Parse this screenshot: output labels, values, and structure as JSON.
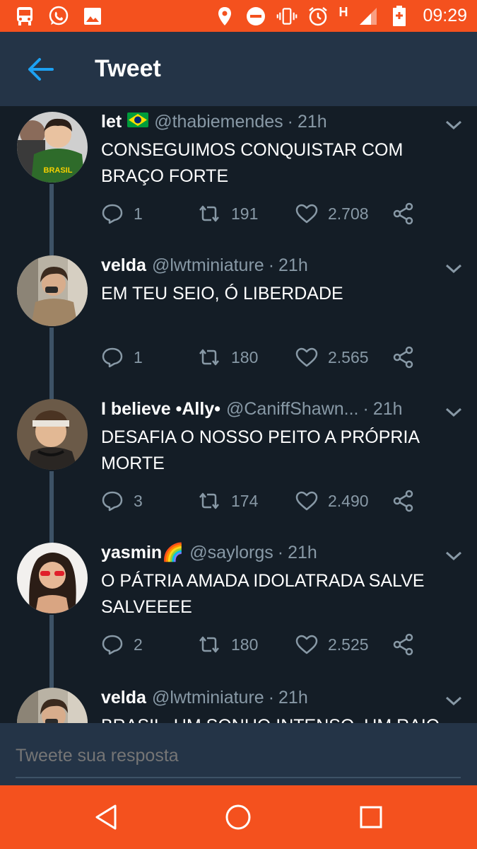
{
  "status_bar": {
    "time": "09:29",
    "network": "H",
    "left_icons": [
      "bus-icon",
      "whatsapp-icon",
      "image-icon"
    ],
    "right_icons": [
      "location-icon",
      "dnd-icon",
      "vibrate-icon",
      "alarm-icon",
      "signal-icon",
      "battery-icon"
    ]
  },
  "app_bar": {
    "title": "Tweet"
  },
  "tweets": [
    {
      "name": "let",
      "flag": "🇧🇷",
      "handle": "@thabiemendes",
      "dot": "·",
      "time": "21h",
      "text": "CONSEGUIMOS CONQUISTAR COM BRAÇO FORTE",
      "replies": "1",
      "retweets": "191",
      "likes": "2.708",
      "avatar_text": "BRASIL"
    },
    {
      "name": "velda",
      "handle": "@lwtminiature",
      "dot": "·",
      "time": "21h",
      "text": "EM TEU SEIO, Ó LIBERDADE",
      "replies": "1",
      "retweets": "180",
      "likes": "2.565"
    },
    {
      "name": "I believe •Ally•",
      "handle": "@CaniffShawn...",
      "dot": "·",
      "time": "21h",
      "text": "DESAFIA O NOSSO PEITO A PRÓPRIA MORTE",
      "replies": "3",
      "retweets": "174",
      "likes": "2.490"
    },
    {
      "name": "yasmin🌈",
      "handle": "@saylorgs",
      "dot": "·",
      "time": "21h",
      "text": "O PÁTRIA AMADA IDOLATRADA SALVE SALVEEEE",
      "replies": "2",
      "retweets": "180",
      "likes": "2.525"
    },
    {
      "name": "velda",
      "handle": "@lwtminiature",
      "dot": "·",
      "time": "21h",
      "text": "BRASIL, UM SONHO INTENSO, UM RAIO"
    }
  ],
  "reply": {
    "placeholder": "Tweete sua resposta"
  },
  "colors": {
    "accent": "#f4511e",
    "background": "#141d26",
    "bar": "#243447",
    "muted": "#8899a6",
    "link": "#1da1f2"
  }
}
